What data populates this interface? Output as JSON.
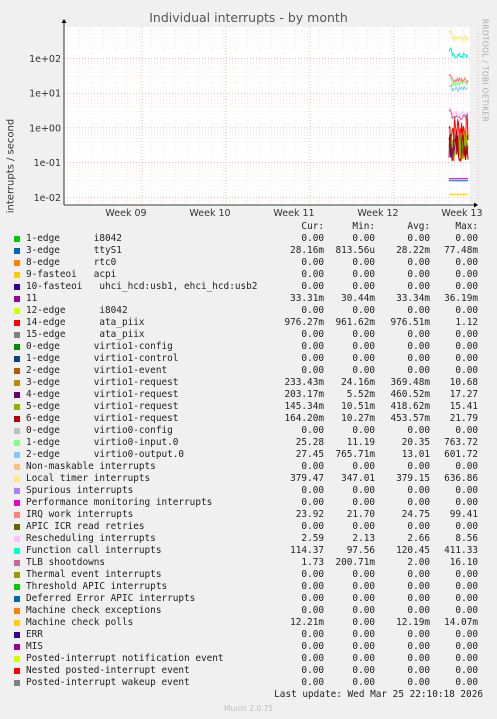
{
  "title": "Individual interrupts - by month",
  "side_label": "RRDTOOL / TOBI OETIKER",
  "footer": {
    "last_update": "Last update: Wed Mar 25 22:10:18 2026",
    "version": "Munin 2.0.75"
  },
  "legend_header": {
    "cur": "Cur:",
    "min": "Min:",
    "avg": "Avg:",
    "max": "Max:"
  },
  "chart_data": {
    "type": "line",
    "title": "Individual interrupts - by month",
    "ylabel": "interrupts / second",
    "xlabel": "",
    "yscale": "log",
    "ylim": [
      0.006,
      800
    ],
    "y_ticks": [
      "1e-02",
      "1e-01",
      "1e+00",
      "1e+01",
      "1e+02"
    ],
    "x_ticks": [
      "Week 09",
      "Week 10",
      "Week 11",
      "Week 12",
      "Week 13"
    ],
    "grid": true,
    "series": [
      {
        "name": "1-edge      i8042",
        "color": "#00cc00",
        "cur": "0.00",
        "min": "0.00",
        "avg": "0.00",
        "max": "0.00",
        "level": null
      },
      {
        "name": "3-edge      ttyS1",
        "color": "#0066b3",
        "cur": "28.16m",
        "min": "813.56u",
        "avg": "28.22m",
        "max": "77.48m",
        "level": 0.03
      },
      {
        "name": "8-edge      rtc0",
        "color": "#ff8000",
        "cur": "0.00",
        "min": "0.00",
        "avg": "0.00",
        "max": "0.00",
        "level": null
      },
      {
        "name": "9-fasteoi   acpi",
        "color": "#ffcc00",
        "cur": "0.00",
        "min": "0.00",
        "avg": "0.00",
        "max": "0.00",
        "level": null
      },
      {
        "name": "10-fasteoi   uhci_hcd:usb1, ehci_hcd:usb2",
        "color": "#330099",
        "cur": "0.00",
        "min": "0.00",
        "avg": "0.00",
        "max": "0.00",
        "level": null
      },
      {
        "name": "11",
        "color": "#990099",
        "cur": "33.31m",
        "min": "30.44m",
        "avg": "33.34m",
        "max": "36.19m",
        "level": 0.034
      },
      {
        "name": "12-edge      i8042",
        "color": "#ccff00",
        "cur": "0.00",
        "min": "0.00",
        "avg": "0.00",
        "max": "0.00",
        "level": null
      },
      {
        "name": "14-edge      ata_piix",
        "color": "#ff0000",
        "cur": "976.27m",
        "min": "961.62m",
        "avg": "976.51m",
        "max": "1.12",
        "level": 0.98
      },
      {
        "name": "15-edge      ata_piix",
        "color": "#808080",
        "cur": "0.00",
        "min": "0.00",
        "avg": "0.00",
        "max": "0.00",
        "level": null
      },
      {
        "name": "0-edge      virtio1-config",
        "color": "#008f00",
        "cur": "0.00",
        "min": "0.00",
        "avg": "0.00",
        "max": "0.00",
        "level": null
      },
      {
        "name": "1-edge      virtio1-control",
        "color": "#00487d",
        "cur": "0.00",
        "min": "0.00",
        "avg": "0.00",
        "max": "0.00",
        "level": null
      },
      {
        "name": "2-edge      virtio1-event",
        "color": "#b35a00",
        "cur": "0.00",
        "min": "0.00",
        "avg": "0.00",
        "max": "0.00",
        "level": null
      },
      {
        "name": "3-edge      virtio1-request",
        "color": "#b38f00",
        "cur": "233.43m",
        "min": "24.16m",
        "avg": "369.48m",
        "max": "10.68",
        "level": 0.3
      },
      {
        "name": "4-edge      virtio1-request",
        "color": "#6b006b",
        "cur": "203.17m",
        "min": "5.52m",
        "avg": "460.52m",
        "max": "17.27",
        "level": 0.3
      },
      {
        "name": "5-edge      virtio1-request",
        "color": "#8fb300",
        "cur": "145.34m",
        "min": "10.51m",
        "avg": "418.62m",
        "max": "15.41",
        "level": 0.3
      },
      {
        "name": "6-edge      virtio1-request",
        "color": "#b30000",
        "cur": "164.20m",
        "min": "10.27m",
        "avg": "453.57m",
        "max": "21.79",
        "level": 0.3
      },
      {
        "name": "0-edge      virtio0-config",
        "color": "#bebebe",
        "cur": "0.00",
        "min": "0.00",
        "avg": "0.00",
        "max": "0.00",
        "level": null
      },
      {
        "name": "1-edge      virtio0-input.0",
        "color": "#80ff80",
        "cur": "25.28",
        "min": "11.19",
        "avg": "20.35",
        "max": "763.72",
        "level": 20
      },
      {
        "name": "2-edge      virtio0-output.0",
        "color": "#80c9ff",
        "cur": "27.45",
        "min": "765.71m",
        "avg": "13.01",
        "max": "601.72",
        "level": 13
      },
      {
        "name": "Non-maskable interrupts",
        "color": "#ffc080",
        "cur": "0.00",
        "min": "0.00",
        "avg": "0.00",
        "max": "0.00",
        "level": null
      },
      {
        "name": "Local timer interrupts",
        "color": "#ffe680",
        "cur": "379.47",
        "min": "347.01",
        "avg": "379.15",
        "max": "636.86",
        "level": 379
      },
      {
        "name": "Spurious interrupts",
        "color": "#aa80ff",
        "cur": "0.00",
        "min": "0.00",
        "avg": "0.00",
        "max": "0.00",
        "level": null
      },
      {
        "name": "Performance monitoring interrupts",
        "color": "#ee00cc",
        "cur": "0.00",
        "min": "0.00",
        "avg": "0.00",
        "max": "0.00",
        "level": null
      },
      {
        "name": "IRQ work interrupts",
        "color": "#ff8080",
        "cur": "23.92",
        "min": "21.70",
        "avg": "24.75",
        "max": "99.41",
        "level": 24
      },
      {
        "name": "APIC ICR read retries",
        "color": "#666600",
        "cur": "0.00",
        "min": "0.00",
        "avg": "0.00",
        "max": "0.00",
        "level": null
      },
      {
        "name": "Rescheduling interrupts",
        "color": "#ffbfff",
        "cur": "2.59",
        "min": "2.13",
        "avg": "2.66",
        "max": "8.56",
        "level": 2.6
      },
      {
        "name": "Function call interrupts",
        "color": "#00ffcc",
        "cur": "114.37",
        "min": "97.56",
        "avg": "120.45",
        "max": "411.33",
        "level": 120
      },
      {
        "name": "TLB shootdowns",
        "color": "#cc6699",
        "cur": "1.73",
        "min": "200.71m",
        "avg": "2.00",
        "max": "16.10",
        "level": 2
      },
      {
        "name": "Thermal event interrupts",
        "color": "#999900",
        "cur": "0.00",
        "min": "0.00",
        "avg": "0.00",
        "max": "0.00",
        "level": null
      },
      {
        "name": "Threshold APIC interrupts",
        "color": "#00cc00",
        "cur": "0.00",
        "min": "0.00",
        "avg": "0.00",
        "max": "0.00",
        "level": null
      },
      {
        "name": "Deferred Error APIC interrupts",
        "color": "#0066b3",
        "cur": "0.00",
        "min": "0.00",
        "avg": "0.00",
        "max": "0.00",
        "level": null
      },
      {
        "name": "Machine check exceptions",
        "color": "#ff8000",
        "cur": "0.00",
        "min": "0.00",
        "avg": "0.00",
        "max": "0.00",
        "level": null
      },
      {
        "name": "Machine check polls",
        "color": "#ffcc00",
        "cur": "12.21m",
        "min": "0.00",
        "avg": "12.19m",
        "max": "14.07m",
        "level": 0.0122
      },
      {
        "name": "ERR",
        "color": "#330099",
        "cur": "0.00",
        "min": "0.00",
        "avg": "0.00",
        "max": "0.00",
        "level": null
      },
      {
        "name": "MIS",
        "color": "#990099",
        "cur": "0.00",
        "min": "0.00",
        "avg": "0.00",
        "max": "0.00",
        "level": null
      },
      {
        "name": "Posted-interrupt notification event",
        "color": "#ccff00",
        "cur": "0.00",
        "min": "0.00",
        "avg": "0.00",
        "max": "0.00",
        "level": null
      },
      {
        "name": "Nested posted-interrupt event",
        "color": "#ff0000",
        "cur": "0.00",
        "min": "0.00",
        "avg": "0.00",
        "max": "0.00",
        "level": null
      },
      {
        "name": "Posted-interrupt wakeup event",
        "color": "#808080",
        "cur": "0.00",
        "min": "0.00",
        "avg": "0.00",
        "max": "0.00",
        "level": null
      }
    ]
  }
}
